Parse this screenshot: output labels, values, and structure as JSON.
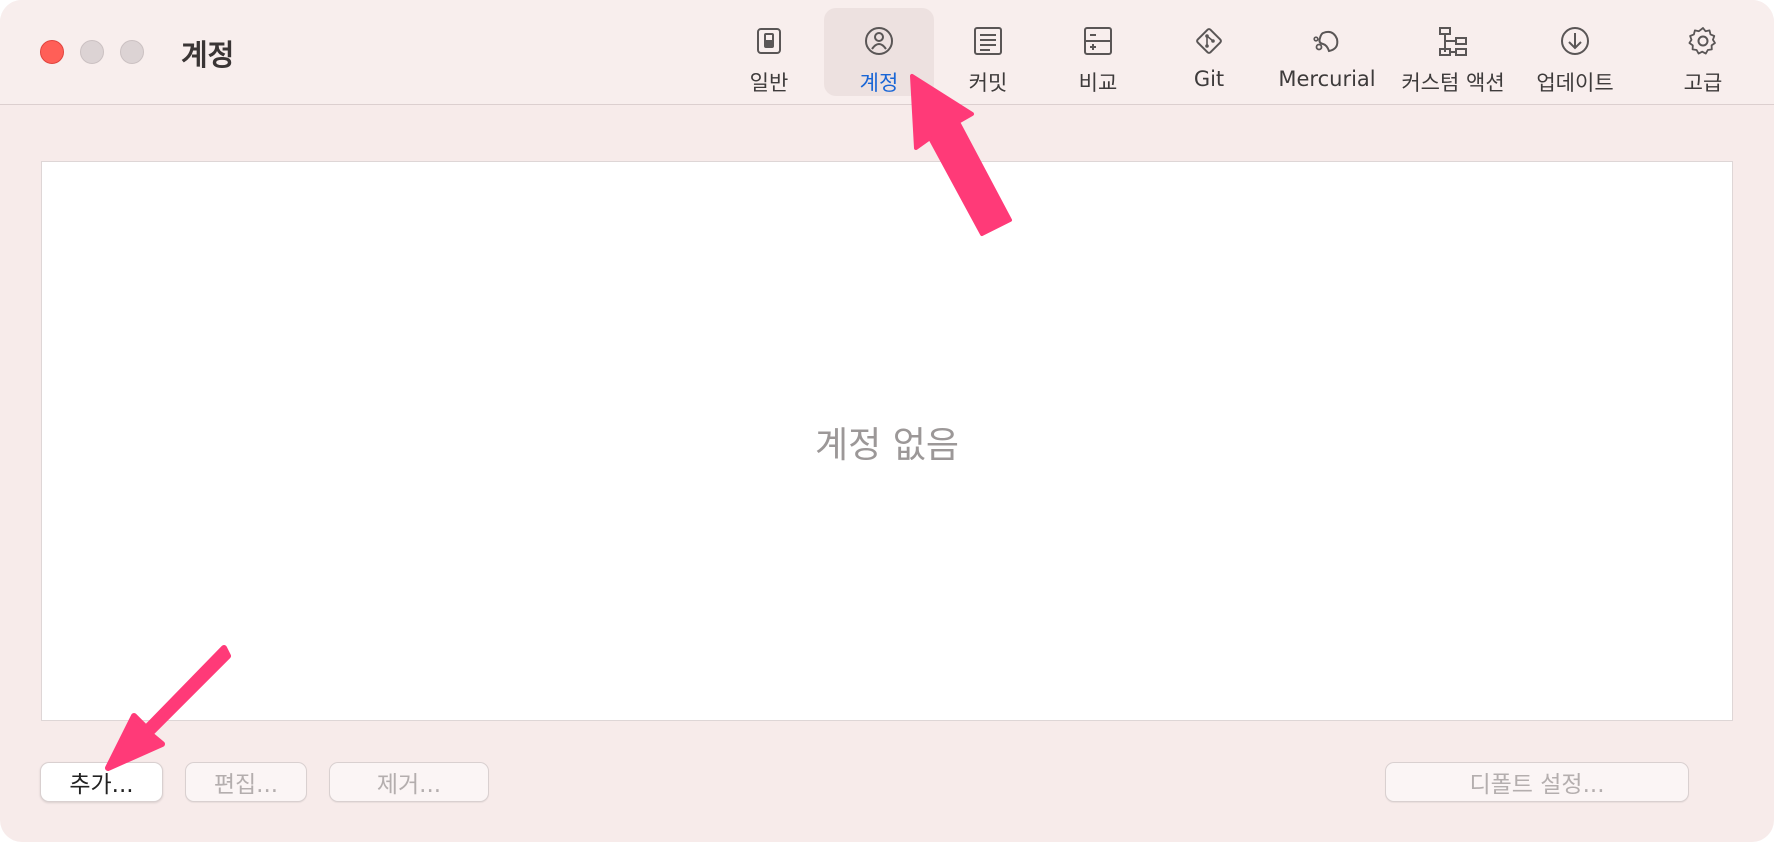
{
  "window": {
    "title": "계정"
  },
  "toolbar": {
    "items": [
      {
        "label": "일반",
        "icon": "switch-icon"
      },
      {
        "label": "계정",
        "icon": "person-icon"
      },
      {
        "label": "커밋",
        "icon": "document-lines-icon"
      },
      {
        "label": "비교",
        "icon": "diff-icon"
      },
      {
        "label": "Git",
        "icon": "git-icon"
      },
      {
        "label": "Mercurial",
        "icon": "mercurial-icon"
      },
      {
        "label": "커스텀 액션",
        "icon": "hierarchy-icon"
      },
      {
        "label": "업데이트",
        "icon": "download-icon"
      },
      {
        "label": "고급",
        "icon": "gear-icon"
      }
    ],
    "selected": "계정"
  },
  "main": {
    "empty_message": "계정 없음"
  },
  "buttons": {
    "add": "추가...",
    "edit": "편집...",
    "remove": "제거...",
    "set_default": "디폴트 설정..."
  },
  "colors": {
    "accent": "#1a66d6",
    "window_bg": "#f7ebea",
    "close_button": "#ff5f57",
    "annotation_arrow": "#ff3a78"
  }
}
